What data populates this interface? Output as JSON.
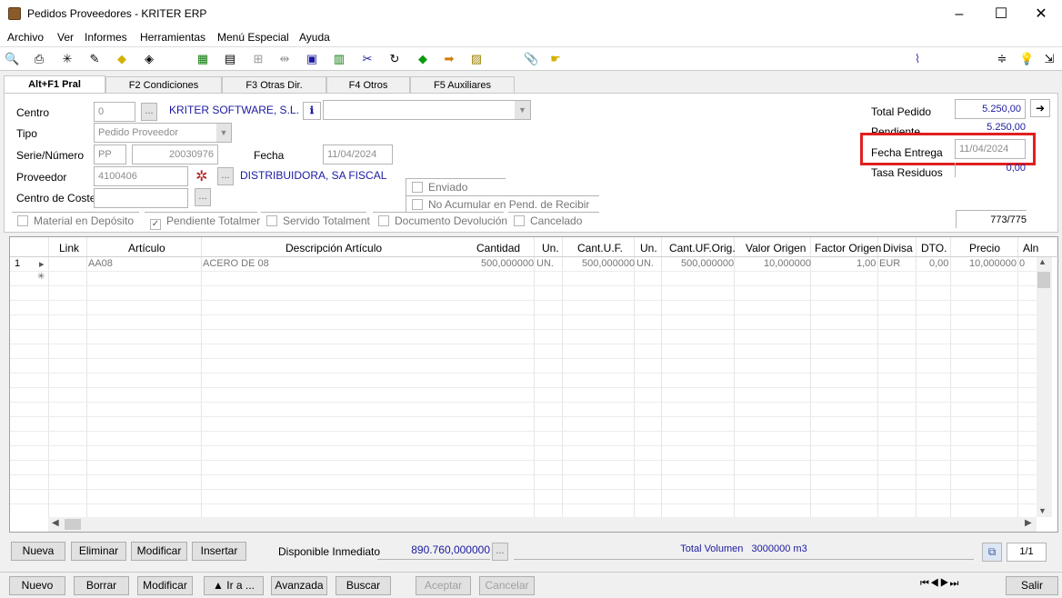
{
  "window": {
    "title": "Pedidos Proveedores - KRITER ERP",
    "minimize": "–",
    "maximize": "☐",
    "close": "✕"
  },
  "menu": [
    "Archivo",
    "Ver",
    "Informes",
    "Herramientas",
    "Menú Especial",
    "Ayuda"
  ],
  "tabs": [
    "Alt+F1 Pral",
    "F2 Condiciones",
    "F3 Otras Dir.",
    "F4 Otros",
    "F5 Auxiliares"
  ],
  "form": {
    "centro_label": "Centro",
    "centro_value": "0",
    "centro_name": "KRITER SOFTWARE, S.L.",
    "tipo_label": "Tipo",
    "tipo_value": "Pedido Proveedor",
    "serie_label": "Serie/Número",
    "serie_value": "PP",
    "numero_value": "20030976",
    "fecha_label": "Fecha",
    "fecha_value": "11/04/2024",
    "proveedor_label": "Proveedor",
    "proveedor_value": "4100406",
    "proveedor_name": "DISTRIBUIDORA, SA FISCAL",
    "centro_coste_label": "Centro de Coste",
    "enviado": "Enviado",
    "no_acumular": "No Acumular en Pend. de Recibir",
    "total_pedido_label": "Total Pedido",
    "total_pedido_value": "5.250,00",
    "pendiente_label": "Pendiente",
    "pendiente_value": "5.250,00",
    "fecha_entrega_label": "Fecha Entrega",
    "fecha_entrega_value": "11/04/2024",
    "tasa_residuos_label": "Tasa Residuos",
    "tasa_residuos_value": "0,00",
    "record_counter": "773/775",
    "checks": [
      "Material en Depósito",
      "Pendiente Totalmer",
      "Servido Totalment",
      "Documento Devolución",
      "Cancelado"
    ]
  },
  "grid": {
    "columns": [
      "Link",
      "Artículo",
      "Descripción Artículo",
      "Cantidad",
      "Un.",
      "Cant.U.F.",
      "Un.",
      "Cant.UF.Orig.",
      "Valor Origen",
      "Factor Origen",
      "Divisa",
      "DTO.",
      "Precio",
      "Aln"
    ],
    "rows": [
      [
        "1",
        "AA08",
        "ACERO DE 08",
        "500,000000",
        "UN.",
        "500,000000",
        "UN.",
        "500,000000",
        "10,000000",
        "1,00",
        "EUR",
        "0,00",
        "10,000000",
        "0"
      ]
    ]
  },
  "lines_bar": {
    "buttons": [
      "Nueva",
      "Eliminar",
      "Modificar",
      "Insertar"
    ],
    "disponible_label": "Disponible Inmediato",
    "disponible_value": "890.760,000000",
    "total_volumen": "Total Volumen   3000000 m3",
    "page": "1/1"
  },
  "bottom_bar": {
    "buttons": [
      "Nuevo",
      "Borrar",
      "Modificar",
      "▲ Ir a ...",
      "Avanzada",
      "Buscar",
      "Aceptar",
      "Cancelar"
    ],
    "exit": "Salir"
  },
  "highlight_color": "#e02020"
}
